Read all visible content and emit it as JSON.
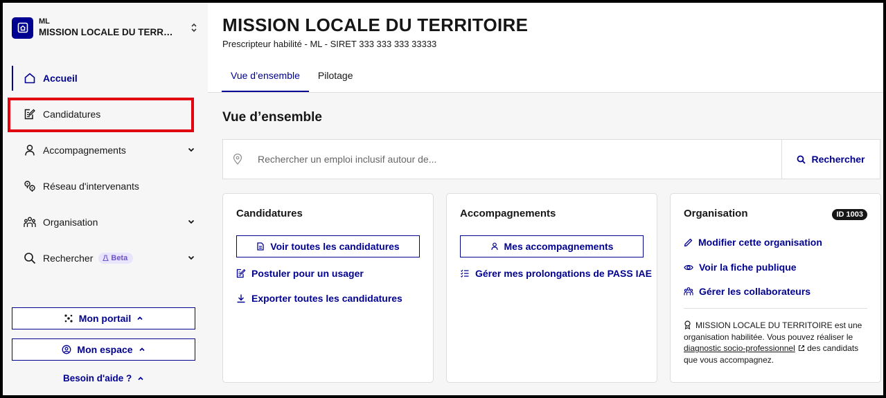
{
  "sidebar": {
    "org_switcher": {
      "short": "ML",
      "name": "MISSION LOCALE DU TERRITOIRE"
    },
    "nav": [
      {
        "label": "Accueil",
        "icon": "home-icon",
        "active": true
      },
      {
        "label": "Candidatures",
        "icon": "file-edit-icon",
        "highlighted": true
      },
      {
        "label": "Accompagnements",
        "icon": "user-icon",
        "expandable": true
      },
      {
        "label": "Réseau d'intervenants",
        "icon": "map-pins-icon"
      },
      {
        "label": "Organisation",
        "icon": "team-icon",
        "expandable": true
      },
      {
        "label": "Rechercher",
        "icon": "search-icon",
        "badge": "Beta",
        "expandable": true
      }
    ],
    "portal_button": "Mon portail",
    "space_button": "Mon espace",
    "help_link": "Besoin d'aide ?"
  },
  "header": {
    "title": "MISSION LOCALE DU TERRITOIRE",
    "subtitle": "Prescripteur habilité - ML - SIRET 333 333 333 33333"
  },
  "tabs": [
    {
      "label": "Vue d’ensemble",
      "active": true
    },
    {
      "label": "Pilotage",
      "active": false
    }
  ],
  "overview": {
    "title": "Vue d’ensemble",
    "search": {
      "placeholder": "Rechercher un emploi inclusif autour de...",
      "value": "",
      "button": "Rechercher"
    }
  },
  "cards": {
    "candidatures": {
      "title": "Candidatures",
      "primary_button": "Voir toutes les candidatures",
      "links": [
        "Postuler pour un usager",
        "Exporter toutes les candidatures"
      ]
    },
    "accompagnements": {
      "title": "Accompagnements",
      "primary_button": "Mes accompagnements",
      "links": [
        "Gérer mes prolongations de PASS IAE"
      ]
    },
    "organisation": {
      "title": "Organisation",
      "badge": "ID 1003",
      "links": [
        "Modifier cette organisation",
        "Voir la fiche publique",
        "Gérer les collaborateurs"
      ],
      "info_before": "MISSION LOCALE DU TERRITOIRE est une organisation habilitée. Vous pouvez réaliser le ",
      "info_link": "diagnostic socio-professionnel",
      "info_after": " des candidats que vous accompagnez."
    }
  },
  "colors": {
    "primary": "#000091",
    "highlight": "#e1000f",
    "sidebar_bg": "#f6f6f6",
    "beta_bg": "#e8e4fb",
    "beta_text": "#6e54c8"
  }
}
